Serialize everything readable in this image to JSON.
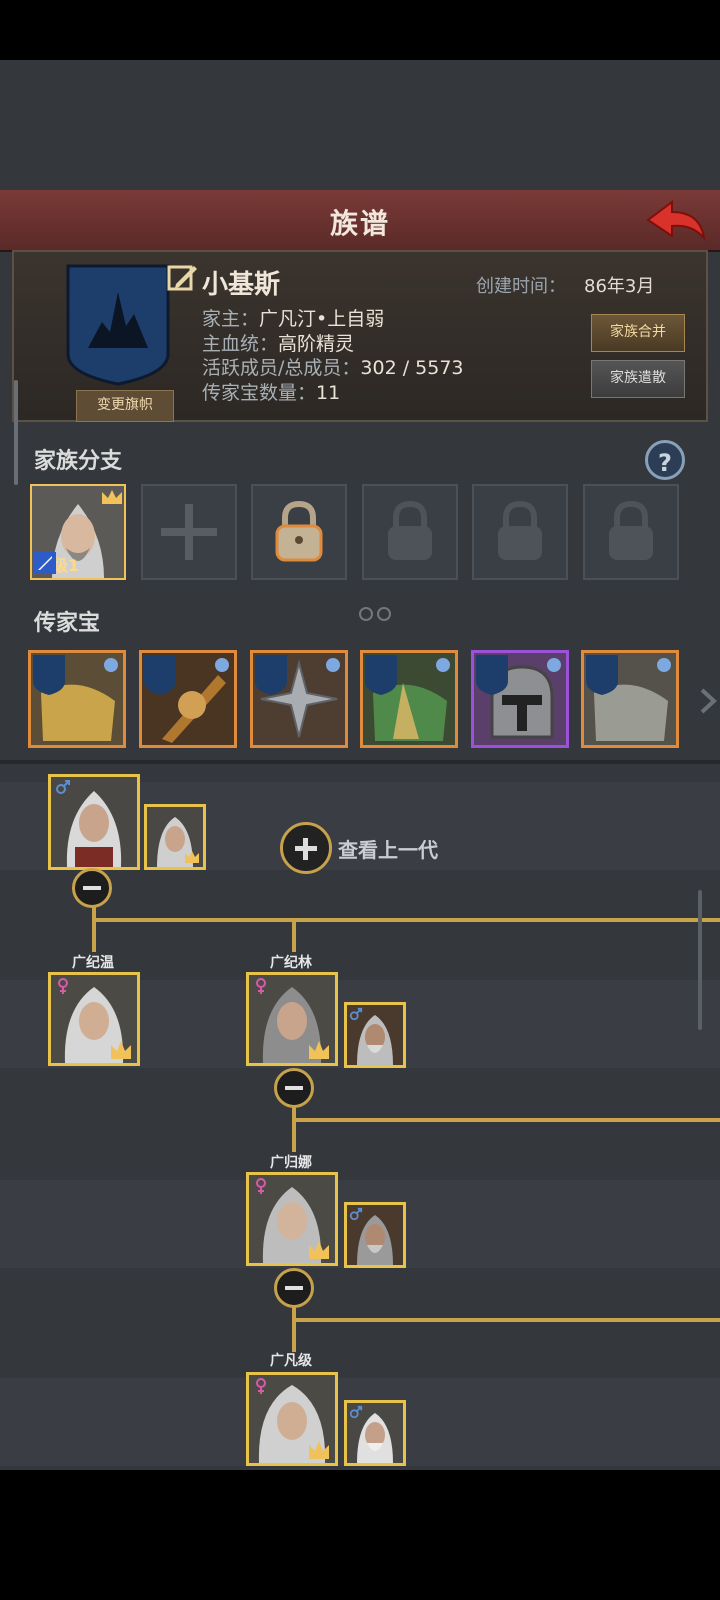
{
  "header": {
    "title": "族谱"
  },
  "family": {
    "name": "小基斯",
    "created_label": "创建时间：",
    "created_value": "86年3月",
    "head_label": "家主：",
    "head_value": "广凡汀•上自弱",
    "bloodline_label": "主血统：",
    "bloodline_value": "高阶精灵",
    "members_label": "活跃成员/总成员：",
    "members_value": "302 / 5573",
    "heirloom_count_label": "传家宝数量：",
    "heirloom_count_value": "11",
    "change_flag_label": "变更旗帜",
    "merge_label": "家族合并",
    "disband_label": "家族遣散"
  },
  "branches": {
    "label": "家族分支",
    "slots": [
      {
        "state": "active",
        "level_text": "等级1"
      },
      {
        "state": "empty"
      },
      {
        "state": "locked-gold"
      },
      {
        "state": "locked"
      },
      {
        "state": "locked"
      },
      {
        "state": "locked"
      }
    ]
  },
  "heirlooms": {
    "label": "传家宝",
    "items": [
      {
        "name": "golden-armor",
        "rarity": "legendary"
      },
      {
        "name": "dragon-weapon",
        "rarity": "legendary"
      },
      {
        "name": "shuriken",
        "rarity": "legendary"
      },
      {
        "name": "green-armor",
        "rarity": "legendary"
      },
      {
        "name": "knight-helm",
        "rarity": "epic"
      },
      {
        "name": "silver-armor",
        "rarity": "legendary"
      }
    ]
  },
  "tree": {
    "view_prev_label": "查看上一代",
    "members": [
      {
        "name": "广纪温"
      },
      {
        "name": "广纪林"
      },
      {
        "name": "广归娜"
      },
      {
        "name": "广凡级"
      }
    ]
  },
  "colors": {
    "gold": "#e7c34a",
    "legendary": "#e08a3c",
    "epic": "#9b52d8",
    "title_bar": "#7a3a37"
  }
}
